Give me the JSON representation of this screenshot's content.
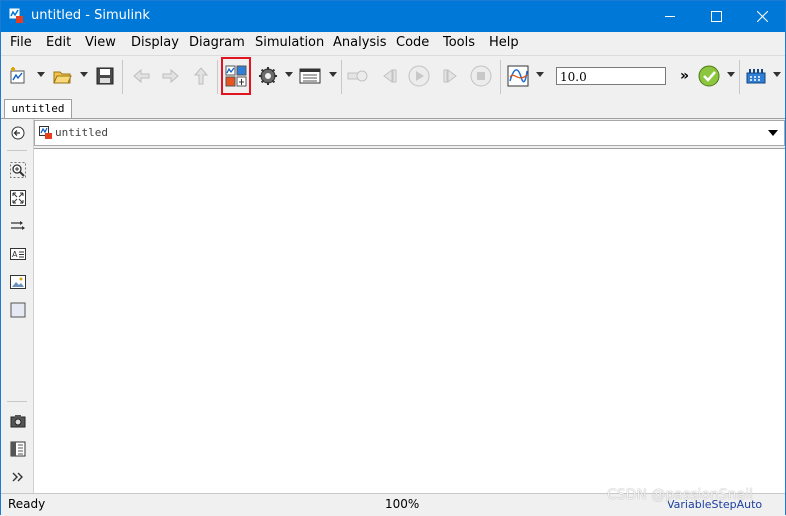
{
  "window": {
    "title": "untitled - Simulink",
    "controls": [
      "minimize-icon",
      "maximize-icon",
      "close-icon"
    ]
  },
  "menubar": {
    "items": [
      "File",
      "Edit",
      "View",
      "Display",
      "Diagram",
      "Simulation",
      "Analysis",
      "Code",
      "Tools",
      "Help"
    ]
  },
  "toolbar": {
    "stop_time": "10.0",
    "overflow": "»",
    "icons": [
      "new-model-icon",
      "open-icon",
      "save-icon",
      "back-icon",
      "forward-icon",
      "up-icon",
      "library-browser-icon",
      "model-configuration-icon",
      "model-explorer-icon",
      "step-back-icon",
      "run-icon",
      "step-forward-icon",
      "stop-icon",
      "data-inspector-icon",
      "check-icon",
      "build-icon"
    ],
    "highlight_color": "#e0151f"
  },
  "tabs": [
    {
      "label": "untitled"
    }
  ],
  "address": {
    "path": "untitled"
  },
  "palette": {
    "icons": [
      "hide-browser-icon",
      "zoom-icon",
      "fit-to-view-icon",
      "route-lines-icon",
      "annotation-icon",
      "image-icon",
      "area-icon",
      "screenshot-icon",
      "model-browser-icon",
      "expand-icon"
    ]
  },
  "status": {
    "left": "Ready",
    "zoom": "100%",
    "solver": "VariableStepAuto"
  },
  "watermark": "CSDN @passionSnail",
  "colors": {
    "titlebar": "#0078d7",
    "accent": "#1e7ad4"
  }
}
